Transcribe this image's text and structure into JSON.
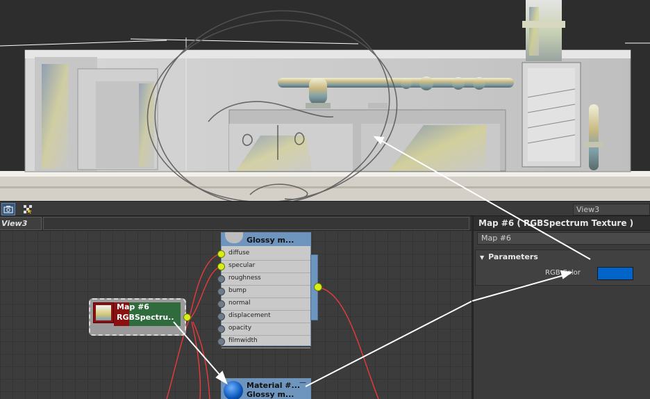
{
  "toolbar": {
    "view_dropdown": "View3"
  },
  "node_editor": {
    "view_tab": "View3",
    "material_node_top": {
      "title": "Glossy m...",
      "slots": [
        "diffuse",
        "specular",
        "roughness",
        "bump",
        "normal",
        "displacement",
        "opacity",
        "filmwidth"
      ],
      "connected_slots": [
        "diffuse",
        "specular"
      ]
    },
    "map_node": {
      "name": "Map #6",
      "type": "RGBSpectru.."
    },
    "material_node_bottom": {
      "title": "Material #...",
      "subtitle": "Glossy m...",
      "minimize": "—"
    }
  },
  "properties": {
    "title": "Map #6  ( RGBSpectrum Texture )",
    "name_field": "Map #6",
    "rollout_title": "Parameters",
    "rgb_label": "RGB Color",
    "rgb_color": "#0064c8"
  },
  "colors": {
    "accent": "#6e95bd",
    "connected_socket": "#d8ee1a",
    "wire": "#e83b3b"
  }
}
